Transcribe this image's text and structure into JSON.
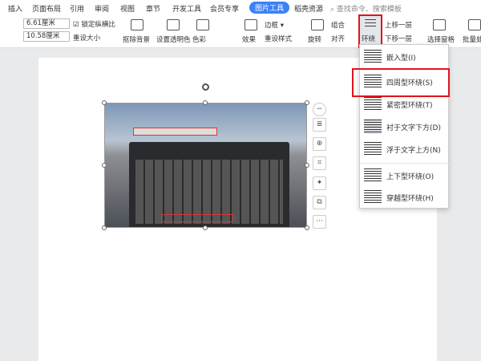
{
  "tabs": [
    "插入",
    "页面布局",
    "引用",
    "审阅",
    "视图",
    "章节",
    "开发工具",
    "会员专享",
    "图片工具",
    "稻壳资源"
  ],
  "search_placeholder": "查找命令、搜索模板",
  "ribbon": {
    "width": "6.61厘米",
    "height": "10.58厘米",
    "lock_ratio": "锁定纵横比",
    "reset_size": "重设大小",
    "remove_bg": "抠除背景",
    "set_transparent": "设置透明色",
    "color": "色彩",
    "effects": "效果",
    "border": "边框",
    "reset_style": "重设样式",
    "rotate": "旋转",
    "group": "组合",
    "align": "对齐",
    "wrap": "环绕",
    "bring_forward": "上移一层",
    "send_backward": "下移一层",
    "selection_pane": "选择窗格",
    "batch": "批量处"
  },
  "wrap_menu": [
    "嵌入型(I)",
    "四周型环绕(S)",
    "紧密型环绕(T)",
    "衬于文字下方(D)",
    "浮于文字上方(N)",
    "上下型环绕(O)",
    "穿越型环绕(H)"
  ],
  "float_toolbar": [
    "layout-options-icon",
    "zoom-icon",
    "crop-icon",
    "idea-icon",
    "replace-icon",
    "more-icon"
  ],
  "colors": {
    "accent": "#3b82f6",
    "highlight": "#e0141e"
  }
}
